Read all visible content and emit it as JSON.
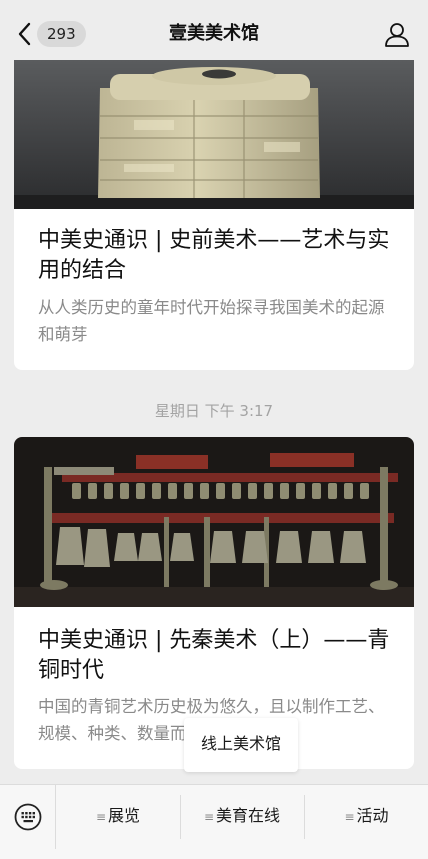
{
  "topbar": {
    "back_count": "293",
    "title": "壹美美术馆"
  },
  "articles": [
    {
      "title": "中美史通识 | 史前美术——艺术与实用的结合",
      "description": "从人类历史的童年时代开始探寻我国美术的起源和萌芽",
      "image_icon": "jade-cong-photo"
    },
    {
      "title": "中美史通识 | 先秦美术（上）——青铜时代",
      "description": "中国的青铜艺术历史极为悠久，且以制作工艺、规模、种类、数量而冠于世界之最。",
      "image_icon": "bronze-bells-photo"
    }
  ],
  "timestamp": "星期日 下午 3:17",
  "popup": {
    "label": "线上美术馆"
  },
  "bottom_menu": {
    "keyboard_icon": "keyboard-icon",
    "items": [
      {
        "label": "展览"
      },
      {
        "label": "美育在线"
      },
      {
        "label": "活动"
      }
    ]
  },
  "colors": {
    "background": "#ededed",
    "card": "#ffffff",
    "muted_text": "#8a8a8a",
    "timestamp_text": "#a3a3a3"
  }
}
